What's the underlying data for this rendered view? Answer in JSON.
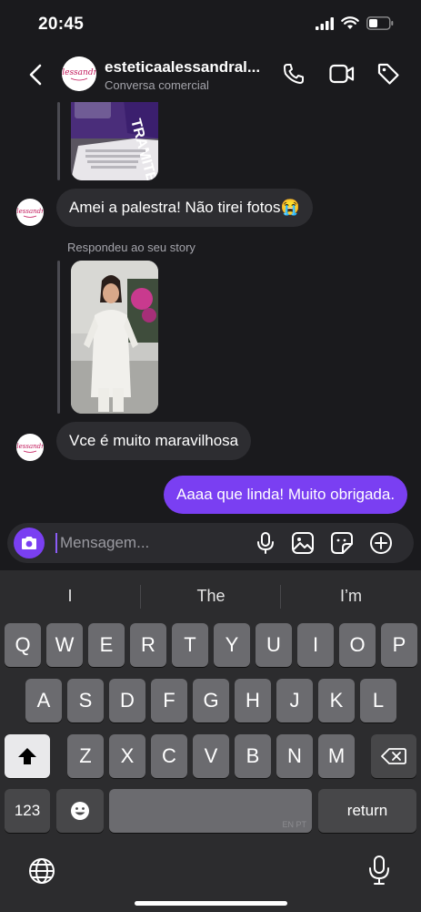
{
  "status_bar": {
    "time": "20:45"
  },
  "header": {
    "name": "esteticaalessandral...",
    "subtitle": "Conversa comercial",
    "avatar_brand": "Alessandra"
  },
  "chat": {
    "messages": [
      {
        "type": "story_reply",
        "from": "them"
      },
      {
        "type": "text",
        "from": "them",
        "text": "Amei a palestra! Não tirei fotos😭"
      },
      {
        "type": "caption",
        "text": "Respondeu ao seu story"
      },
      {
        "type": "story_reply",
        "from": "them"
      },
      {
        "type": "text",
        "from": "them",
        "text": "Vce é muito maravilhosa"
      },
      {
        "type": "text",
        "from": "me",
        "text": "Aaaa que linda! Muito obrigada."
      }
    ],
    "card_text": "TRAMITE"
  },
  "composer": {
    "placeholder": "Mensagem..."
  },
  "keyboard": {
    "suggestions": [
      "I",
      "The",
      "I’m"
    ],
    "row1": [
      "Q",
      "W",
      "E",
      "R",
      "T",
      "Y",
      "U",
      "I",
      "O",
      "P"
    ],
    "row2": [
      "A",
      "S",
      "D",
      "F",
      "G",
      "H",
      "J",
      "K",
      "L"
    ],
    "row3": [
      "Z",
      "X",
      "C",
      "V",
      "B",
      "N",
      "M"
    ],
    "numbers_label": "123",
    "return_label": "return",
    "space_lang": "EN PT"
  },
  "colors": {
    "accent": "#7a3ff2",
    "bg": "#1a1a1d",
    "bubble_in": "#2d2d31"
  }
}
